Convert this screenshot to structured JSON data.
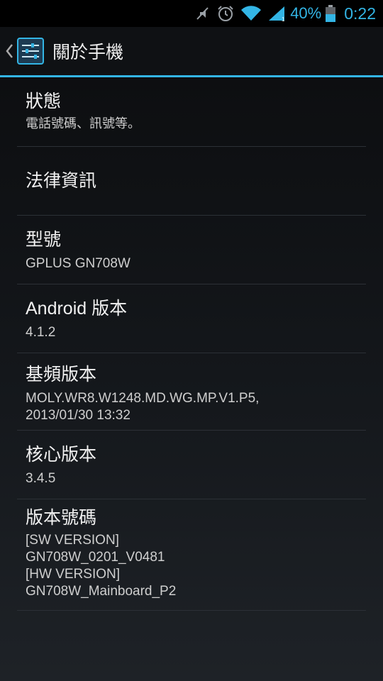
{
  "status_bar": {
    "icons": [
      "mute-icon",
      "alarm-icon",
      "wifi-icon",
      "signal-icon",
      "battery-icon"
    ],
    "battery": "40%",
    "time": "0:22",
    "accent": "#33b5e5"
  },
  "action_bar": {
    "title": "關於手機",
    "icon": "settings-icon"
  },
  "items": [
    {
      "title": "狀態",
      "summary": "電話號碼、訊號等。"
    },
    {
      "title": "法律資訊"
    },
    {
      "title": "型號",
      "summary": "GPLUS GN708W"
    },
    {
      "title": "Android 版本",
      "summary": "4.1.2"
    },
    {
      "title": "基頻版本",
      "summary_lines": [
        "MOLY.WR8.W1248.MD.WG.MP.V1.P5,",
        "2013/01/30 13:32"
      ]
    },
    {
      "title": "核心版本",
      "summary": "3.4.5"
    },
    {
      "title": "版本號碼",
      "summary_lines": [
        "[SW VERSION]",
        "GN708W_0201_V0481",
        "[HW VERSION]",
        "GN708W_Mainboard_P2"
      ]
    }
  ]
}
